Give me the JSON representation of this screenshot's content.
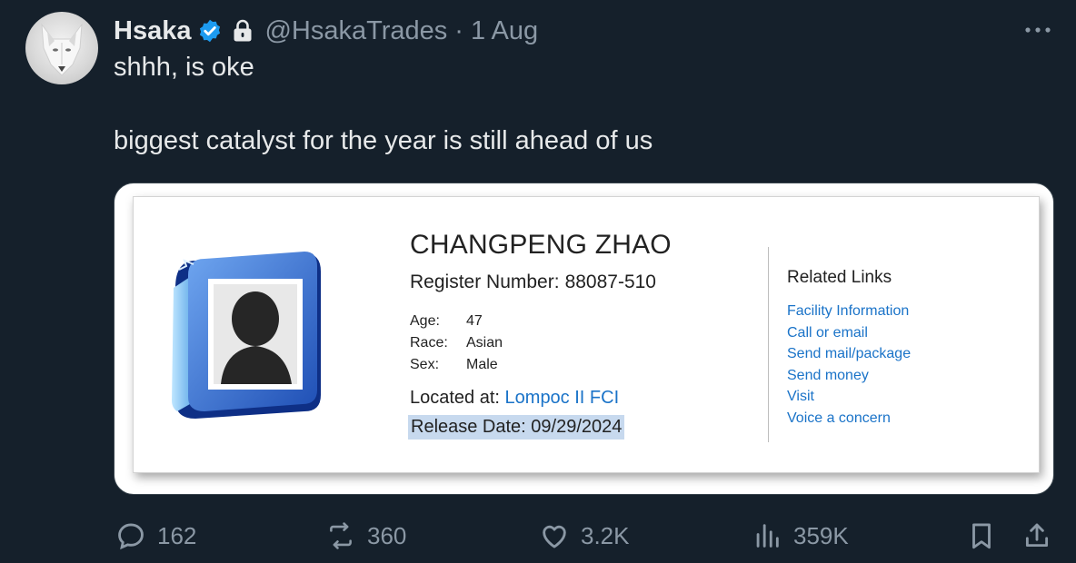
{
  "tweet": {
    "author": {
      "name": "Hsaka",
      "handle": "@HsakaTrades",
      "separator": "·",
      "date": "1 Aug"
    },
    "text_line_1": "shhh, is oke",
    "text_line_2": "biggest catalyst for the year is still ahead of us"
  },
  "card": {
    "name": "CHANGPENG ZHAO",
    "register_label": "Register Number:",
    "register_number": "88087-510",
    "facts": [
      {
        "label": "Age:",
        "value": "47"
      },
      {
        "label": "Race:",
        "value": "Asian"
      },
      {
        "label": "Sex:",
        "value": "Male"
      }
    ],
    "located_label": "Located at:",
    "located_value": "Lompoc II FCI",
    "release_text": "Release Date: 09/29/2024",
    "related_title": "Related Links",
    "related_links": [
      "Facility Information",
      "Call or email",
      "Send mail/package",
      "Send money",
      "Visit",
      "Voice a concern"
    ]
  },
  "actions": {
    "replies": "162",
    "reposts": "360",
    "likes": "3.2K",
    "views": "359K"
  },
  "colors": {
    "background": "#15202b",
    "secondary_text": "#8b98a5",
    "verified_badge": "#1d9bf0",
    "link": "#1a73c8",
    "release_highlight": "#c7d9ee"
  },
  "icons": [
    "verified-badge-icon",
    "lock-icon",
    "more-icon",
    "reply-icon",
    "repost-icon",
    "like-icon",
    "views-icon",
    "bookmark-icon",
    "share-icon",
    "inmate-photo-icon"
  ]
}
